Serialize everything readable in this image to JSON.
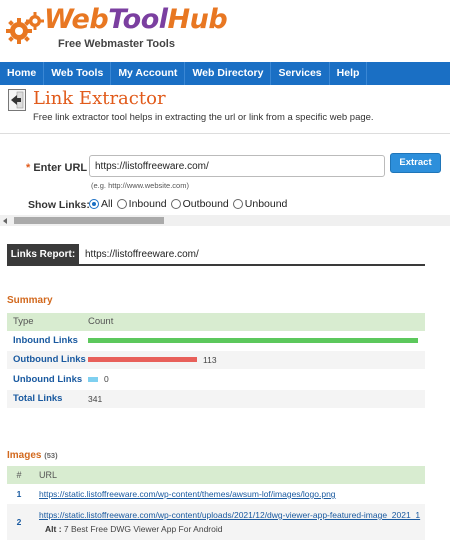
{
  "brand": {
    "name_part1": "Web",
    "name_part2": "Tool",
    "name_part3": "Hub",
    "tagline": "Free Webmaster Tools"
  },
  "nav": {
    "items": [
      "Home",
      "Web Tools",
      "My Account",
      "Web Directory",
      "Services",
      "Help"
    ],
    "color": "#1a6fc4"
  },
  "page": {
    "title": "Link Extractor",
    "description": "Free link extractor tool helps in extracting the url or link from a specific web page."
  },
  "form": {
    "url_label": "Enter URL",
    "url_required_mark": "*",
    "url_value": "https://listoffreeware.com/",
    "url_hint": "(e.g. http://www.website.com)",
    "extract_label": "Extract",
    "show_links_label": "Show Links:",
    "options": [
      "All",
      "Inbound",
      "Outbound",
      "Unbound"
    ],
    "selected": "All"
  },
  "report": {
    "tab_label": "Links Report:",
    "url": "https://listoffreeware.com/"
  },
  "summary": {
    "heading": "Summary",
    "col_type": "Type",
    "col_count": "Count",
    "rows": [
      {
        "type": "Inbound Links",
        "count": "",
        "fraction": 1.0,
        "color": "#5cc85c"
      },
      {
        "type": "Outbound Links",
        "count": "113",
        "fraction": 0.33,
        "color": "#e8605a"
      },
      {
        "type": "Unbound Links",
        "count": "0",
        "fraction": 0.0,
        "color": "#7fd0f0"
      },
      {
        "type": "Total Links",
        "count": "341"
      }
    ]
  },
  "images": {
    "heading": "Images",
    "count": "(53)",
    "col_num": "#",
    "col_url": "URL",
    "rows": [
      {
        "num": "1",
        "url": "https://static.listoffreeware.com/wp-content/themes/awsum-lof/images/logo.png",
        "alt_label": "",
        "alt": ""
      },
      {
        "num": "2",
        "url": "https://static.listoffreeware.com/wp-content/uploads/2021/12/dwg-viewer-app-featured-image_2021_1",
        "alt_label": "Alt :",
        "alt": "7 Best Free DWG Viewer App For Android"
      }
    ]
  },
  "colors": {
    "accent": "#e15a1a",
    "link": "#1a5aa0",
    "table_header": "#d8ecd0"
  }
}
